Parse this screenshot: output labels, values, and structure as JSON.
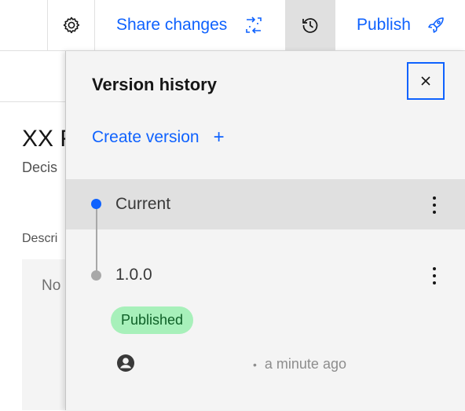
{
  "toolbar": {
    "settings_icon": "gear-icon",
    "share_label": "Share changes",
    "share_icon": "sync-arrows-icon",
    "history_icon": "history-icon",
    "publish_label": "Publish",
    "publish_icon": "rocket-icon"
  },
  "background": {
    "title": "XX F",
    "subtitle": "Decis",
    "description_label": "Descri",
    "description_text": "No"
  },
  "panel": {
    "title": "Version history",
    "close_icon": "close-icon",
    "create_version_label": "Create version",
    "create_version_plus": "+",
    "versions": [
      {
        "label": "Current",
        "status_color": "#0f62fe"
      },
      {
        "label": "1.0.0",
        "status_color": "#a8a8a8",
        "badge": "Published",
        "separator": "•",
        "time": "a minute ago"
      }
    ]
  },
  "colors": {
    "accent": "#0f62fe",
    "panel_bg": "#f4f4f4",
    "selected_row": "#e0e0e0",
    "badge_bg": "#a7f0ba",
    "badge_text": "#0e6027"
  }
}
